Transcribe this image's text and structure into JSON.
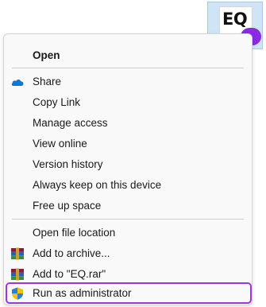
{
  "desktop_icon": {
    "label": "EQ"
  },
  "menu": {
    "items": [
      {
        "label": "Open",
        "icon": "none"
      },
      {
        "label": "Share",
        "icon": "onedrive-cloud-icon"
      },
      {
        "label": "Copy Link",
        "icon": "none"
      },
      {
        "label": "Manage access",
        "icon": "none"
      },
      {
        "label": "View online",
        "icon": "none"
      },
      {
        "label": "Version history",
        "icon": "none"
      },
      {
        "label": "Always keep on this device",
        "icon": "none"
      },
      {
        "label": "Free up space",
        "icon": "none"
      },
      {
        "label": "Open file location",
        "icon": "none"
      },
      {
        "label": "Add to archive...",
        "icon": "winrar-icon"
      },
      {
        "label": "Add to \"EQ.rar\"",
        "icon": "winrar-icon"
      },
      {
        "label": "Run as administrator",
        "icon": "uac-shield-icon"
      }
    ]
  },
  "colors": {
    "highlight": "#9b37e0",
    "onedrive": "#0f78d4"
  }
}
